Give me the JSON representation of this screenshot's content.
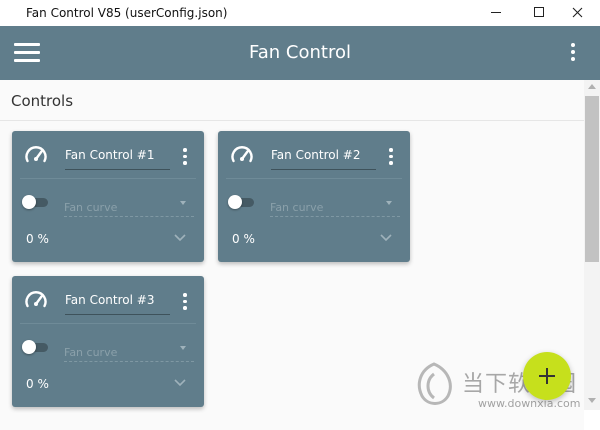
{
  "window": {
    "title": "Fan Control V85 (userConfig.json)"
  },
  "appbar": {
    "title": "Fan Control",
    "menu_icon": "hamburger-menu-icon",
    "overflow_icon": "more-vert-icon"
  },
  "section": {
    "title": "Controls"
  },
  "cards": [
    {
      "name": "Fan Control #1",
      "curve_placeholder": "Fan curve",
      "percent": "0 %",
      "enabled": false
    },
    {
      "name": "Fan Control #2",
      "curve_placeholder": "Fan curve",
      "percent": "0 %",
      "enabled": false
    },
    {
      "name": "Fan Control #3",
      "curve_placeholder": "Fan curve",
      "percent": "0 %",
      "enabled": false
    }
  ],
  "fab": {
    "label": "+",
    "icon": "plus-icon"
  },
  "watermark": {
    "brand_text": "当下软件园",
    "url": "www.downxia.com"
  },
  "colors": {
    "appbar": "#607d8b",
    "card": "#607d8b",
    "fab": "#c6e01c",
    "background": "#fafafa"
  }
}
